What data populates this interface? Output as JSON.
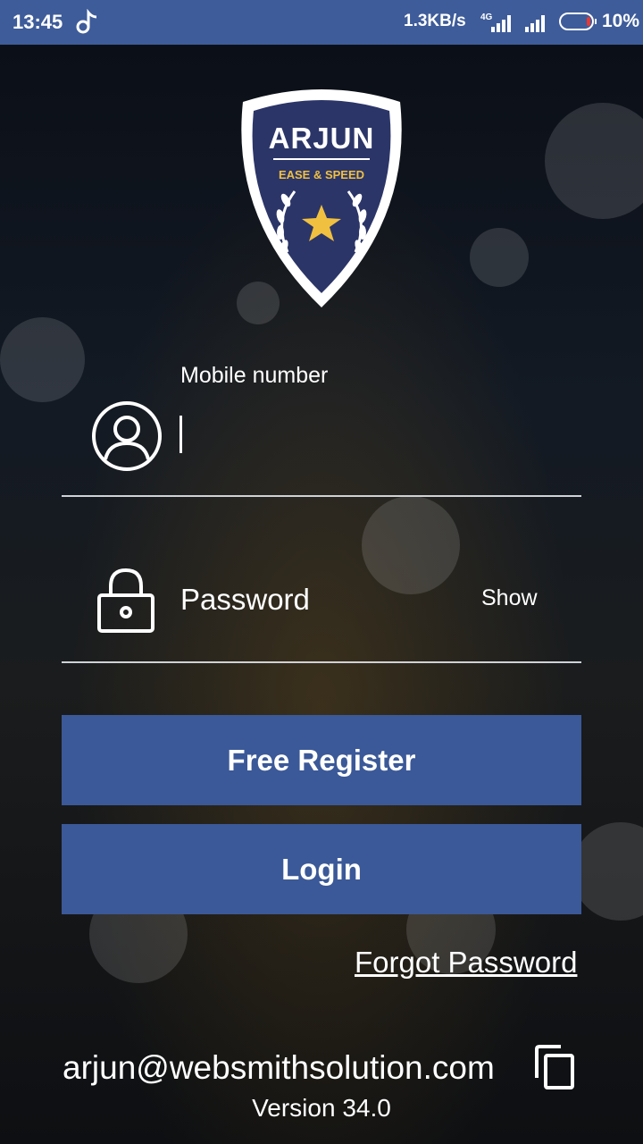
{
  "status_bar": {
    "time": "13:45",
    "net_rate": "1.3KB/s",
    "network_type": "4G",
    "battery": "10%",
    "icons": [
      "music-note-icon",
      "signal-4g-icon",
      "signal-icon",
      "battery-icon"
    ]
  },
  "logo": {
    "title": "ARJUN",
    "tagline": "EASE & SPEED"
  },
  "form": {
    "mobile_label": "Mobile number",
    "mobile_value": "",
    "password_placeholder": "Password",
    "show_label": "Show"
  },
  "buttons": {
    "register": "Free Register",
    "login": "Login"
  },
  "forgot_password": "Forgot Password",
  "footer": {
    "email": "arjun@websmithsolution.com",
    "version": "Version 34.0"
  },
  "colors": {
    "status_bar": "#3e5c9a",
    "button": "#3b5998",
    "logo_shield": "#2b3568",
    "logo_accent": "#f0c040"
  }
}
